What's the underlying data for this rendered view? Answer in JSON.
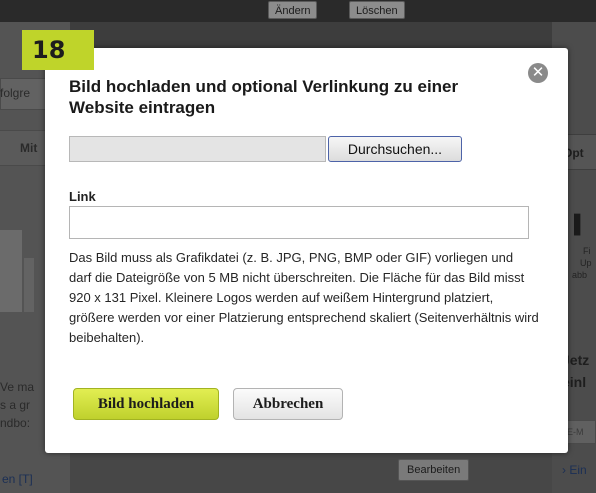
{
  "background": {
    "top_buttons": [
      "Ändern",
      "Löschen"
    ],
    "left_texts": [
      "folgre",
      "Mit",
      "Ve ma",
      "s a gr",
      "ndbo:"
    ],
    "left_link": "en [T]",
    "right_texts": [
      "Opt",
      "Jetz",
      "einl"
    ],
    "right_small": [
      "Fi",
      "Up",
      "abb"
    ],
    "right_input_placeholder": "E-M",
    "right_link": "› Ein",
    "edit_button": "Bearbeiten"
  },
  "step_badge": "18",
  "dialog": {
    "title": "Bild hochladen und optional Verlinkung zu einer Website eintragen",
    "close_icon": "close-icon",
    "file_path_value": "",
    "browse_button": "Durchsuchen...",
    "link_label": "Link",
    "link_value": "",
    "description": "Das Bild muss als Grafikdatei (z. B. JPG, PNG, BMP oder GIF) vorliegen und darf die Dateigröße von 5 MB nicht überschreiten. Die Fläche für das Bild misst 920 x 131 Pixel. Kleinere Logos werden auf weißem Hintergrund platziert, größere werden vor einer Platzierung entsprechend skaliert (Seitenverhältnis wird beibehalten).",
    "upload_button": "Bild hochladen",
    "cancel_button": "Abbrechen"
  },
  "colors": {
    "accent": "#bfd42a",
    "overlay": "#3d3d3d",
    "browse_border": "#4d63a8"
  }
}
